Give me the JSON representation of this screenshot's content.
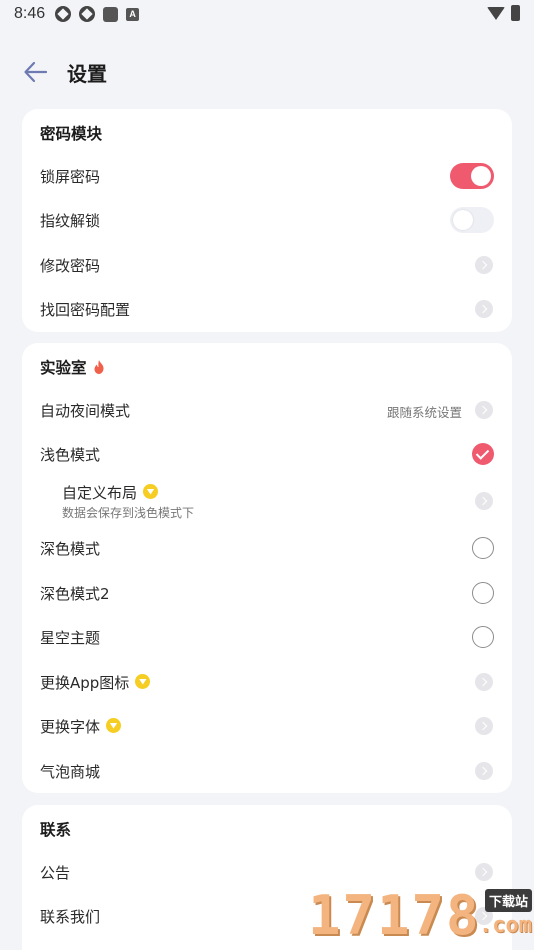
{
  "status_bar": {
    "time": "8:46",
    "notif_a": "A"
  },
  "header": {
    "title": "设置"
  },
  "password_section": {
    "title": "密码模块",
    "items": [
      {
        "label": "锁屏密码",
        "control": "toggle",
        "state": "on"
      },
      {
        "label": "指纹解锁",
        "control": "toggle",
        "state": "off"
      },
      {
        "label": "修改密码",
        "control": "chevron"
      },
      {
        "label": "找回密码配置",
        "control": "chevron"
      }
    ]
  },
  "lab_section": {
    "title": "实验室",
    "items": [
      {
        "label": "自动夜间模式",
        "hint": "跟随系统设置",
        "control": "chevron"
      },
      {
        "label": "浅色模式",
        "control": "radio",
        "selected": true
      },
      {
        "label": "自定义布局",
        "desc": "数据会保存到浅色模式下",
        "control": "chevron",
        "vip": true
      },
      {
        "label": "深色模式",
        "control": "radio",
        "selected": false
      },
      {
        "label": "深色模式2",
        "control": "radio",
        "selected": false
      },
      {
        "label": "星空主题",
        "control": "radio",
        "selected": false
      },
      {
        "label": "更换App图标",
        "control": "chevron",
        "vip": true
      },
      {
        "label": "更换字体",
        "control": "chevron",
        "vip": true
      },
      {
        "label": "气泡商城",
        "control": "chevron"
      }
    ]
  },
  "contact_section": {
    "title": "联系",
    "items": [
      {
        "label": "公告",
        "control": "chevron"
      },
      {
        "label": "联系我们",
        "control": "chevron"
      }
    ]
  },
  "watermark": {
    "digits": "17178",
    "tag": "下载站",
    "suffix": ".com"
  },
  "colors": {
    "accent": "#f05a6e",
    "background": "#f3f4f8",
    "card": "#ffffff",
    "vip": "#f6cd22",
    "fire": "#f0604a"
  }
}
